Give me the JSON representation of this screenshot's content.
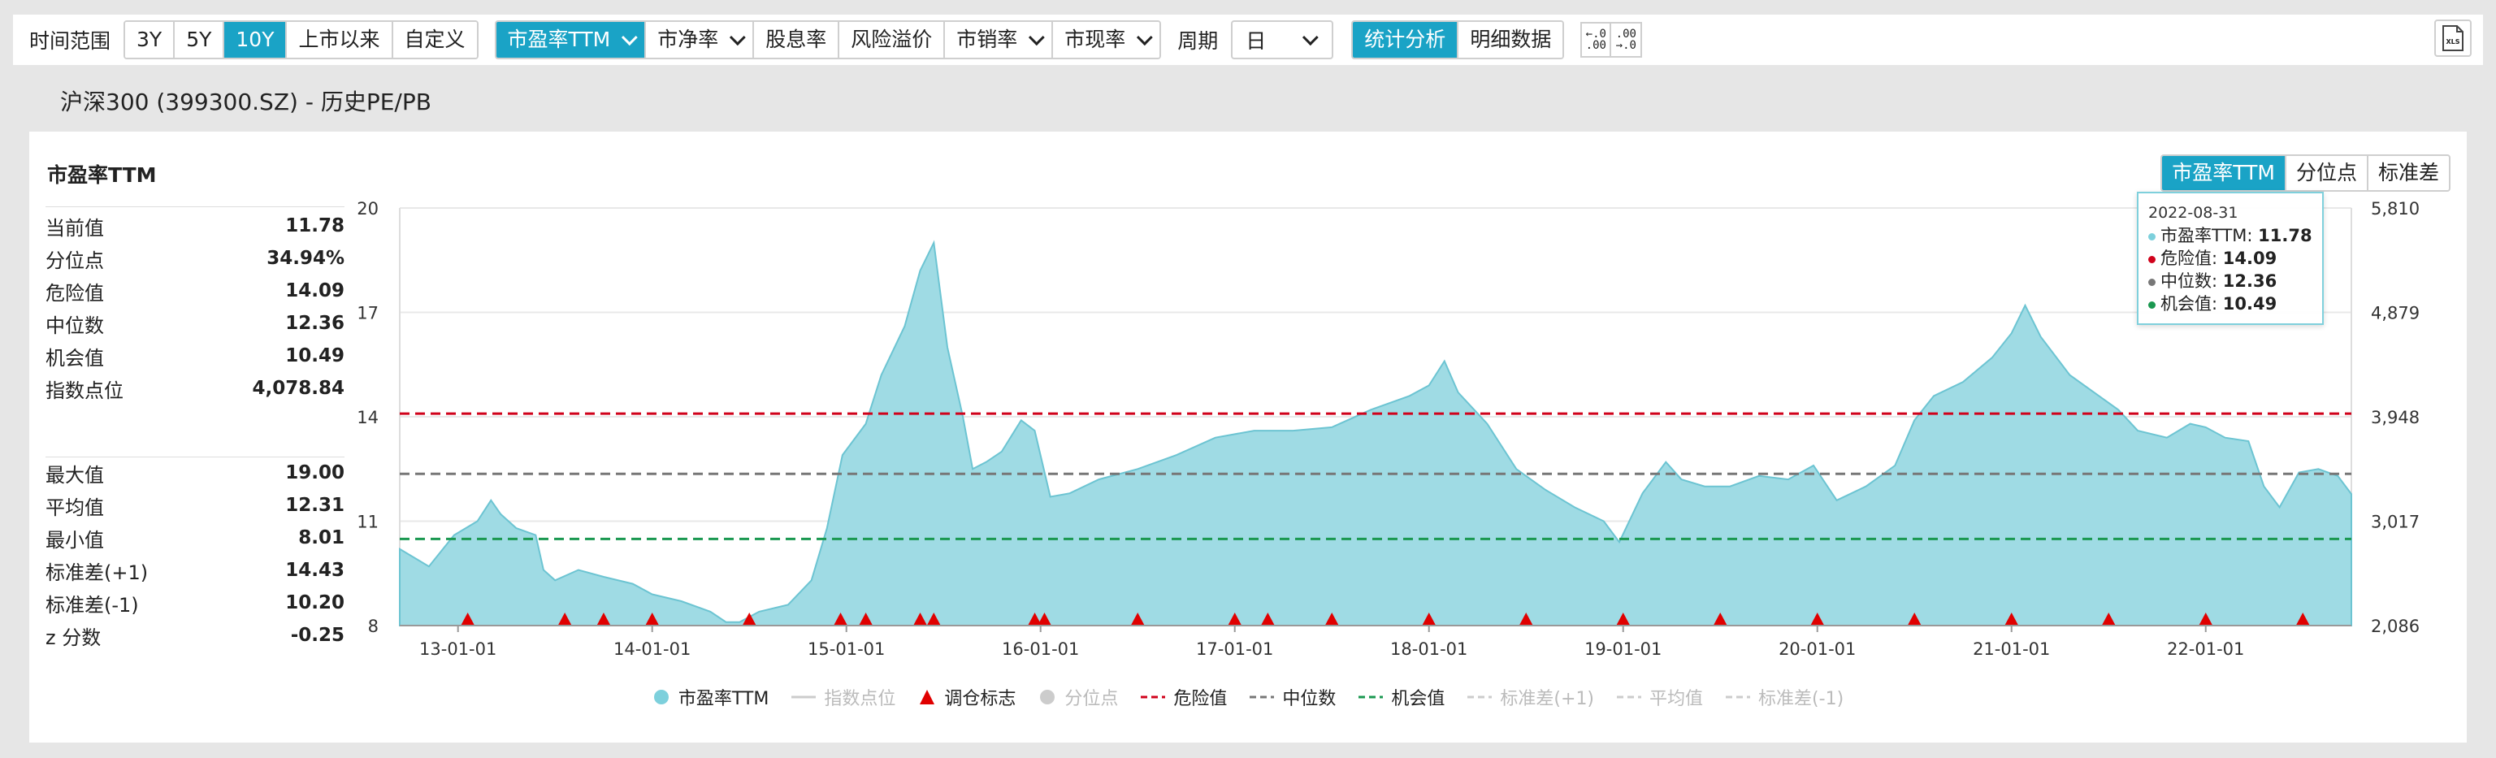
{
  "toolbar": {
    "range_label": "时间范围",
    "range_buttons": [
      "3Y",
      "5Y",
      "10Y",
      "上市以来",
      "自定义"
    ],
    "metric_buttons": [
      "市盈率TTM",
      "市净率",
      "股息率",
      "风险溢价",
      "市销率",
      "市现率"
    ],
    "period_label": "周期",
    "period_value": "日",
    "view_buttons": [
      "统计分析",
      "明细数据"
    ],
    "decimal_inc": "←.0\n.00",
    "decimal_dec": ".00\n→.0",
    "xls": "XLS"
  },
  "subtitle": "沪深300 (399300.SZ) - 历史PE/PB",
  "panel": {
    "title": "市盈率TTM",
    "stats_top": [
      {
        "label": "当前值",
        "value": "11.78"
      },
      {
        "label": "分位点",
        "value": "34.94%"
      },
      {
        "label": "危险值",
        "value": "14.09"
      },
      {
        "label": "中位数",
        "value": "12.36"
      },
      {
        "label": "机会值",
        "value": "10.49"
      },
      {
        "label": "指数点位",
        "value": "4,078.84"
      }
    ],
    "stats_bottom": [
      {
        "label": "最大值",
        "value": "19.00"
      },
      {
        "label": "平均值",
        "value": "12.31"
      },
      {
        "label": "最小值",
        "value": "8.01"
      },
      {
        "label": "标准差(+1)",
        "value": "14.43"
      },
      {
        "label": "标准差(-1)",
        "value": "10.20"
      },
      {
        "label": "z 分数",
        "value": "-0.25"
      }
    ],
    "chart_tabs": [
      "市盈率TTM",
      "分位点",
      "标准差"
    ]
  },
  "tooltip": {
    "date": "2022-08-31",
    "rows": [
      {
        "label": "市盈率TTM:",
        "value": "11.78",
        "color": "#7dd0dc"
      },
      {
        "label": "危险值:",
        "value": "14.09",
        "color": "#d0021b"
      },
      {
        "label": "中位数:",
        "value": "12.36",
        "color": "#777777"
      },
      {
        "label": "机会值:",
        "value": "10.49",
        "color": "#1a9850"
      }
    ]
  },
  "legend": [
    {
      "label": "市盈率TTM",
      "kind": "dot",
      "color": "#7dd0dc",
      "active": true
    },
    {
      "label": "指数点位",
      "kind": "line",
      "color": "#cccccc",
      "active": false
    },
    {
      "label": "调仓标志",
      "kind": "tri",
      "color": "#e00000",
      "active": true
    },
    {
      "label": "分位点",
      "kind": "dot",
      "color": "#cccccc",
      "active": false
    },
    {
      "label": "危险值",
      "kind": "dash",
      "color": "#d0021b",
      "active": true
    },
    {
      "label": "中位数",
      "kind": "dash",
      "color": "#777777",
      "active": true
    },
    {
      "label": "机会值",
      "kind": "dash",
      "color": "#1a9850",
      "active": true
    },
    {
      "label": "标准差(+1)",
      "kind": "dash",
      "color": "#cccccc",
      "active": false
    },
    {
      "label": "平均值",
      "kind": "dash",
      "color": "#cccccc",
      "active": false
    },
    {
      "label": "标准差(-1)",
      "kind": "dash",
      "color": "#cccccc",
      "active": false
    }
  ],
  "chart_data": {
    "type": "area",
    "y_left_ticks": [
      "20",
      "17",
      "14",
      "11",
      "8"
    ],
    "y_right_ticks": [
      "5,810",
      "4,879",
      "3,948",
      "3,017",
      "2,086"
    ],
    "ylim": [
      8,
      20
    ],
    "x_ticks": [
      "13-01-01",
      "14-01-01",
      "15-01-01",
      "16-01-01",
      "17-01-01",
      "18-01-01",
      "19-01-01",
      "20-01-01",
      "21-01-01",
      "22-01-01"
    ],
    "xlim": [
      2012.7,
      2022.75
    ],
    "reference_lines": {
      "danger": 14.09,
      "median": 12.36,
      "opportunity": 10.49
    },
    "series": [
      {
        "name": "市盈率TTM",
        "color": "#7dd0dc",
        "points": [
          [
            2012.7,
            10.2
          ],
          [
            2012.85,
            9.7
          ],
          [
            2012.98,
            10.6
          ],
          [
            2013.1,
            11.0
          ],
          [
            2013.17,
            11.6
          ],
          [
            2013.22,
            11.2
          ],
          [
            2013.3,
            10.8
          ],
          [
            2013.4,
            10.6
          ],
          [
            2013.44,
            9.6
          ],
          [
            2013.5,
            9.3
          ],
          [
            2013.62,
            9.6
          ],
          [
            2013.75,
            9.4
          ],
          [
            2013.9,
            9.2
          ],
          [
            2014.0,
            8.9
          ],
          [
            2014.15,
            8.7
          ],
          [
            2014.3,
            8.4
          ],
          [
            2014.38,
            8.1
          ],
          [
            2014.45,
            8.1
          ],
          [
            2014.55,
            8.4
          ],
          [
            2014.7,
            8.6
          ],
          [
            2014.82,
            9.3
          ],
          [
            2014.9,
            10.8
          ],
          [
            2014.98,
            12.9
          ],
          [
            2015.1,
            13.8
          ],
          [
            2015.18,
            15.2
          ],
          [
            2015.3,
            16.6
          ],
          [
            2015.38,
            18.2
          ],
          [
            2015.45,
            19.0
          ],
          [
            2015.52,
            16.0
          ],
          [
            2015.6,
            14.0
          ],
          [
            2015.65,
            12.5
          ],
          [
            2015.72,
            12.7
          ],
          [
            2015.8,
            13.0
          ],
          [
            2015.9,
            13.9
          ],
          [
            2015.97,
            13.6
          ],
          [
            2016.05,
            11.7
          ],
          [
            2016.15,
            11.8
          ],
          [
            2016.3,
            12.2
          ],
          [
            2016.5,
            12.5
          ],
          [
            2016.7,
            12.9
          ],
          [
            2016.9,
            13.4
          ],
          [
            2017.1,
            13.6
          ],
          [
            2017.3,
            13.6
          ],
          [
            2017.5,
            13.7
          ],
          [
            2017.7,
            14.2
          ],
          [
            2017.9,
            14.6
          ],
          [
            2018.0,
            14.9
          ],
          [
            2018.08,
            15.6
          ],
          [
            2018.15,
            14.7
          ],
          [
            2018.3,
            13.8
          ],
          [
            2018.45,
            12.5
          ],
          [
            2018.6,
            11.9
          ],
          [
            2018.75,
            11.4
          ],
          [
            2018.9,
            11.0
          ],
          [
            2018.98,
            10.4
          ],
          [
            2019.1,
            11.8
          ],
          [
            2019.22,
            12.7
          ],
          [
            2019.3,
            12.2
          ],
          [
            2019.42,
            12.0
          ],
          [
            2019.55,
            12.0
          ],
          [
            2019.7,
            12.3
          ],
          [
            2019.85,
            12.2
          ],
          [
            2019.98,
            12.6
          ],
          [
            2020.1,
            11.6
          ],
          [
            2020.25,
            12.0
          ],
          [
            2020.4,
            12.6
          ],
          [
            2020.5,
            13.9
          ],
          [
            2020.6,
            14.6
          ],
          [
            2020.75,
            15.0
          ],
          [
            2020.9,
            15.7
          ],
          [
            2021.0,
            16.4
          ],
          [
            2021.07,
            17.2
          ],
          [
            2021.15,
            16.3
          ],
          [
            2021.3,
            15.2
          ],
          [
            2021.45,
            14.6
          ],
          [
            2021.55,
            14.2
          ],
          [
            2021.65,
            13.6
          ],
          [
            2021.8,
            13.4
          ],
          [
            2021.92,
            13.8
          ],
          [
            2022.0,
            13.7
          ],
          [
            2022.1,
            13.4
          ],
          [
            2022.22,
            13.3
          ],
          [
            2022.3,
            12.0
          ],
          [
            2022.38,
            11.4
          ],
          [
            2022.48,
            12.4
          ],
          [
            2022.58,
            12.5
          ],
          [
            2022.68,
            12.3
          ],
          [
            2022.75,
            11.78
          ]
        ]
      }
    ],
    "rebalance_marks": [
      2013.05,
      2013.55,
      2013.75,
      2014.0,
      2014.5,
      2014.97,
      2015.1,
      2015.38,
      2015.45,
      2015.97,
      2016.02,
      2016.5,
      2017.0,
      2017.17,
      2017.5,
      2018.0,
      2018.5,
      2019.0,
      2019.5,
      2020.0,
      2020.5,
      2021.0,
      2021.5,
      2022.0,
      2022.5
    ]
  }
}
